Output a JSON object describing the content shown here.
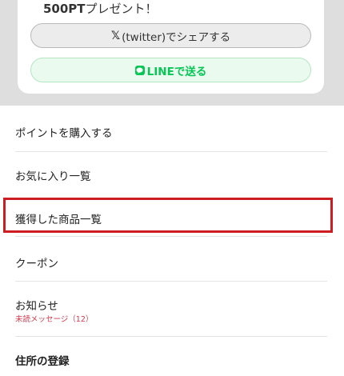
{
  "share": {
    "promo_amount": "500PT",
    "promo_suffix": "プレゼント！",
    "twitter_icon": "x-logo-icon",
    "twitter_label": "(twitter)でシェアする",
    "line_icon": "line-logo-icon",
    "line_label": "LINEで送る"
  },
  "menu": {
    "items": [
      {
        "label": "ポイントを購入する"
      },
      {
        "label": "お気に入り一覧"
      },
      {
        "label": "獲得した商品一覧"
      },
      {
        "label": "クーポン"
      },
      {
        "label": "お知らせ",
        "sub_label": "未読メッセージ（12）"
      },
      {
        "label": "住所の登録"
      }
    ]
  },
  "colors": {
    "line_green": "#06c755",
    "highlight_red": "#cc1d23",
    "unread_red": "#d33a4e",
    "top_area_gray": "#dedede"
  }
}
